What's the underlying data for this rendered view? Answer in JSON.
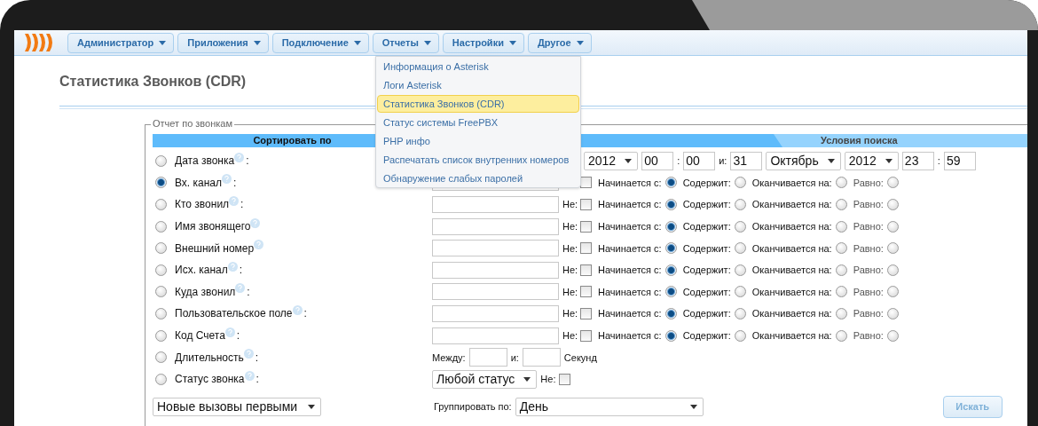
{
  "nav": {
    "items": [
      {
        "label": "Администратор"
      },
      {
        "label": "Приложения"
      },
      {
        "label": "Подключение"
      },
      {
        "label": "Отчеты"
      },
      {
        "label": "Настройки"
      },
      {
        "label": "Другое"
      }
    ]
  },
  "menu": {
    "items": [
      {
        "label": "Информация о Asterisk",
        "selected": false
      },
      {
        "label": "Логи Asterisk",
        "selected": false
      },
      {
        "label": "Статистика Звонков (CDR)",
        "selected": true
      },
      {
        "label": "Статус системы FreePBX",
        "selected": false
      },
      {
        "label": "PHP инфо",
        "selected": false
      },
      {
        "label": "Распечатать список внутренних номеров",
        "selected": false
      },
      {
        "label": "Обнаружение слабых паролей",
        "selected": false
      }
    ]
  },
  "page_title": "Статистика Звонков (CDR)",
  "report": {
    "legend": "Отчет по звонкам",
    "sort_header": "Сортировать по",
    "conditions_header": "Условия поиска",
    "rows": [
      {
        "label": "Дата звонка",
        "suffix": ":",
        "selected": false,
        "condition": {
          "kind": "date",
          "parts": [
            {
              "kind": "select",
              "value": "2012"
            },
            {
              "kind": "input",
              "value": "00"
            },
            {
              "kind": "sep",
              "text": ":"
            },
            {
              "kind": "input",
              "value": "00"
            },
            {
              "kind": "sep",
              "text": "и:"
            },
            {
              "kind": "input",
              "value": "31"
            },
            {
              "kind": "select",
              "value": "Октябрь"
            },
            {
              "kind": "select",
              "value": "2012"
            },
            {
              "kind": "input",
              "value": "23"
            },
            {
              "kind": "sep",
              "text": ":"
            },
            {
              "kind": "input",
              "value": "59"
            }
          ]
        }
      },
      {
        "label": "Вх. канал",
        "suffix": ":",
        "selected": true,
        "condition": {
          "kind": "text",
          "not_checked": false,
          "options": [
            {
              "label": "Начинается с:",
              "selected": true
            },
            {
              "label": "Содержит:",
              "selected": false
            },
            {
              "label": "Оканчивается на:",
              "selected": false
            },
            {
              "label": "Равно:",
              "selected": false
            }
          ]
        }
      },
      {
        "label": "Кто звонил",
        "suffix": ":",
        "selected": false,
        "condition": {
          "kind": "text",
          "not_label": "Не:",
          "not_checked": false,
          "options": [
            {
              "label": "Начинается с:",
              "selected": true
            },
            {
              "label": "Содержит:",
              "selected": false
            },
            {
              "label": "Оканчивается на:",
              "selected": false
            },
            {
              "label": "Равно:",
              "selected": false
            }
          ]
        }
      },
      {
        "label": "Имя звонящего",
        "selected": false,
        "condition": {
          "kind": "text",
          "not_label": "Не:",
          "not_checked": false,
          "options": [
            {
              "label": "Начинается с:",
              "selected": true
            },
            {
              "label": "Содержит:",
              "selected": false
            },
            {
              "label": "Оканчивается на:",
              "selected": false
            },
            {
              "label": "Равно:",
              "selected": false
            }
          ]
        }
      },
      {
        "label": "Внешний номер",
        "selected": false,
        "condition": {
          "kind": "text",
          "not_label": "Не:",
          "not_checked": false,
          "options": [
            {
              "label": "Начинается с:",
              "selected": true
            },
            {
              "label": "Содержит:",
              "selected": false
            },
            {
              "label": "Оканчивается на:",
              "selected": false
            },
            {
              "label": "Равно:",
              "selected": false
            }
          ]
        }
      },
      {
        "label": "Исх. канал",
        "suffix": ":",
        "selected": false,
        "condition": {
          "kind": "text",
          "not_label": "Не:",
          "not_checked": false,
          "options": [
            {
              "label": "Начинается с:",
              "selected": true
            },
            {
              "label": "Содержит:",
              "selected": false
            },
            {
              "label": "Оканчивается на:",
              "selected": false
            },
            {
              "label": "Равно:",
              "selected": false
            }
          ]
        }
      },
      {
        "label": "Куда звонил",
        "suffix": ":",
        "selected": false,
        "condition": {
          "kind": "text",
          "not_label": "Не:",
          "not_checked": false,
          "options": [
            {
              "label": "Начинается с:",
              "selected": true
            },
            {
              "label": "Содержит:",
              "selected": false
            },
            {
              "label": "Оканчивается на:",
              "selected": false
            },
            {
              "label": "Равно:",
              "selected": false
            }
          ]
        }
      },
      {
        "label": "Пользовательское поле",
        "suffix": ":",
        "selected": false,
        "condition": {
          "kind": "text",
          "not_label": "Не:",
          "not_checked": false,
          "options": [
            {
              "label": "Начинается с:",
              "selected": true
            },
            {
              "label": "Содержит:",
              "selected": false
            },
            {
              "label": "Оканчивается на:",
              "selected": false
            },
            {
              "label": "Равно:",
              "selected": false
            }
          ]
        }
      },
      {
        "label": "Код Счета",
        "suffix": ":",
        "selected": false,
        "condition": {
          "kind": "text",
          "not_label": "Не:",
          "not_checked": false,
          "options": [
            {
              "label": "Начинается с:",
              "selected": true
            },
            {
              "label": "Содержит:",
              "selected": false
            },
            {
              "label": "Оканчивается на:",
              "selected": false
            },
            {
              "label": "Равно:",
              "selected": false
            }
          ]
        }
      },
      {
        "label": "Длительность",
        "suffix": ":",
        "selected": false,
        "condition": {
          "kind": "duration",
          "from_label": "Между:",
          "to_label": "и:",
          "unit": "Секунд"
        }
      },
      {
        "label": "Статус звонка",
        "suffix": ":",
        "selected": false,
        "condition": {
          "kind": "status",
          "value": "Любой статус",
          "not_label": "Не:",
          "not_checked": false
        }
      }
    ],
    "order": "Новые вызовы первыми",
    "group_label": "Группировать по:",
    "group_value": "День",
    "search_button": "Искать"
  }
}
